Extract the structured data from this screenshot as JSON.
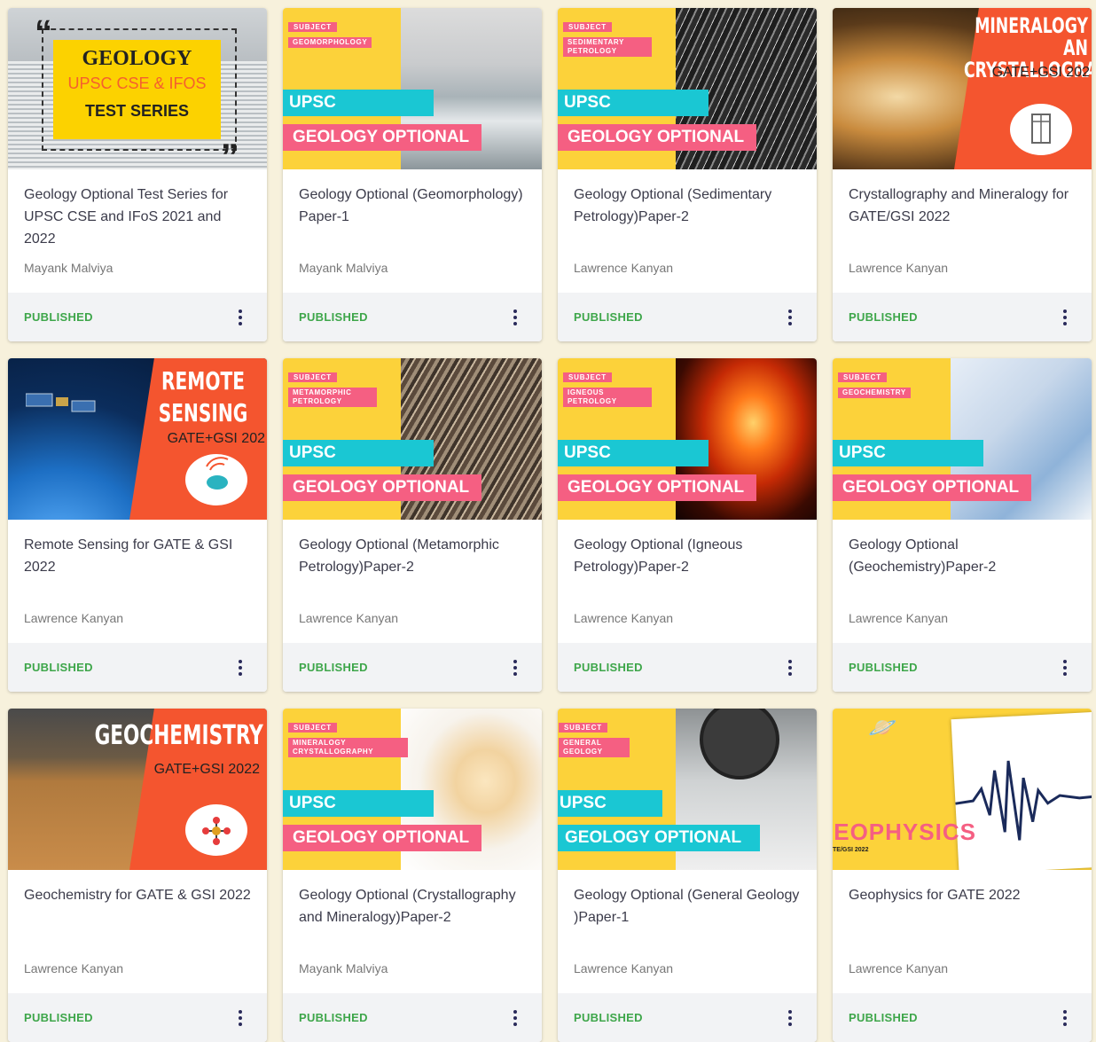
{
  "colors": {
    "background": "#f7f1dc",
    "published": "#3ea64a",
    "upsc_yellow": "#fcd23a",
    "upsc_pink": "#f55f82",
    "upsc_cyan": "#1ac7d3",
    "gate_orange": "#f4552f"
  },
  "icons": {
    "menu": "more-vert-icon"
  },
  "cards": [
    {
      "title": "Geology Optional Test Series for UPSC CSE and IFoS 2021 and 2022",
      "author": "Mayank Malviya",
      "status": "PUBLISHED",
      "thumb": {
        "line1": "GEOLOGY",
        "line2": "UPSC CSE & IFOS",
        "line3": "TEST SERIES",
        "quote_open": "“",
        "quote_close": "”"
      }
    },
    {
      "title": "Geology Optional (Geomorphology) Paper-1",
      "author": "Mayank Malviya",
      "status": "PUBLISHED",
      "thumb": {
        "subject": "SUBJECT",
        "topic": "GEOMORPHOLOGY",
        "upsc": "UPSC",
        "banner": "GEOLOGY OPTIONAL"
      }
    },
    {
      "title": "Geology Optional (Sedimentary Petrology)Paper-2",
      "author": "Lawrence Kanyan",
      "status": "PUBLISHED",
      "thumb": {
        "subject": "SUBJECT",
        "topic": "SEDIMENTARY PETROLOGY",
        "upsc": "UPSC",
        "banner": "GEOLOGY OPTIONAL"
      }
    },
    {
      "title": "Crystallography and Mineralogy for GATE/GSI 2022",
      "author": "Lawrence Kanyan",
      "status": "PUBLISHED",
      "thumb": {
        "heading": "MINERALOGY AN CRYSTALLOGRAPH",
        "sub": "GATE+GSI 202"
      }
    },
    {
      "title": "Remote Sensing for GATE & GSI 2022",
      "author": "Lawrence Kanyan",
      "status": "PUBLISHED",
      "thumb": {
        "heading": "REMOTE SENSING",
        "sub": "GATE+GSI 202"
      }
    },
    {
      "title": "Geology Optional (Metamorphic Petrology)Paper-2",
      "author": "Lawrence Kanyan",
      "status": "PUBLISHED",
      "thumb": {
        "subject": "SUBJECT",
        "topic": "METAMORPHIC PETROLOGY",
        "upsc": "UPSC",
        "banner": "GEOLOGY OPTIONAL"
      }
    },
    {
      "title": "Geology Optional (Igneous Petrology)Paper-2",
      "author": "Lawrence Kanyan",
      "status": "PUBLISHED",
      "thumb": {
        "subject": "SUBJECT",
        "topic": "IGNEOUS PETROLOGY",
        "upsc": "UPSC",
        "banner": "GEOLOGY OPTIONAL"
      }
    },
    {
      "title": "Geology Optional (Geochemistry)Paper-2",
      "author": "Lawrence Kanyan",
      "status": "PUBLISHED",
      "thumb": {
        "subject": "SUBJECT",
        "topic": "GEOCHEMISTRY",
        "upsc": "UPSC",
        "banner": "GEOLOGY OPTIONAL"
      }
    },
    {
      "title": "Geochemistry for GATE & GSI 2022",
      "author": "Lawrence Kanyan",
      "status": "PUBLISHED",
      "thumb": {
        "heading": "GEOCHEMISTRY",
        "sub": "GATE+GSI 2022"
      }
    },
    {
      "title": "Geology Optional (Crystallography and Mineralogy)Paper-2",
      "author": "Mayank Malviya",
      "status": "PUBLISHED",
      "thumb": {
        "subject": "SUBJECT",
        "topic": "MINERALOGY CRYSTALLOGRAPHY",
        "upsc": "UPSC",
        "banner": "GEOLOGY OPTIONAL"
      }
    },
    {
      "title": "Geology Optional (General Geology )Paper-1",
      "author": "Lawrence Kanyan",
      "status": "PUBLISHED",
      "thumb": {
        "subject": "SUBJECT",
        "topic": "GENERAL GEOLOGY",
        "upsc": "UPSC",
        "banner": "GEOLOGY OPTIONAL"
      }
    },
    {
      "title": "Geophysics for GATE 2022",
      "author": "Lawrence Kanyan",
      "status": "PUBLISHED",
      "thumb": {
        "heading": "GEOPHYSICS",
        "sub": "TE/GSI 2022"
      }
    }
  ]
}
